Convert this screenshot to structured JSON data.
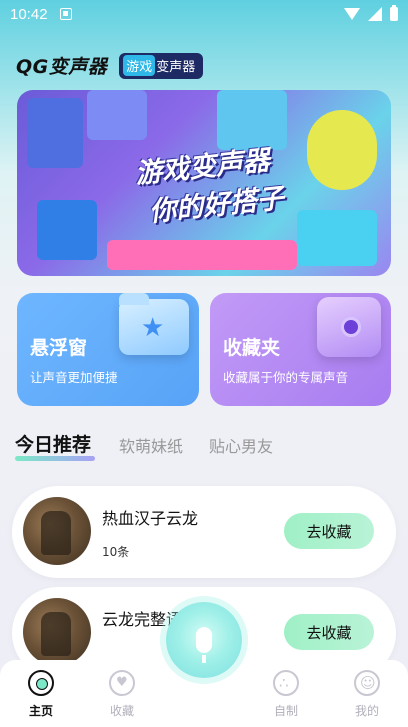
{
  "status_bar": {
    "time": "10:42"
  },
  "header": {
    "app_title": "QG变声器",
    "tag_accent": "游戏",
    "tag_rest": "变声器"
  },
  "banner": {
    "line1": "游戏变声器",
    "line2": "你的好搭子"
  },
  "cards": [
    {
      "title": "悬浮窗",
      "subtitle": "让声音更加便捷",
      "icon": "star-folder-icon"
    },
    {
      "title": "收藏夹",
      "subtitle": "收藏属于你的专属声音",
      "icon": "record-box-icon"
    }
  ],
  "tabs": [
    {
      "label": "今日推荐",
      "active": true
    },
    {
      "label": "软萌妹纸",
      "active": false
    },
    {
      "label": "贴心男友",
      "active": false
    }
  ],
  "list": [
    {
      "title": "热血汉子云龙",
      "count": "10条",
      "button": "去收藏"
    },
    {
      "title": "云龙完整语音",
      "button": "去收藏"
    }
  ],
  "bottom_nav": [
    {
      "label": "主页",
      "active": true
    },
    {
      "label": "收藏",
      "active": false
    },
    {
      "label": "自制",
      "active": false
    },
    {
      "label": "我的",
      "active": false
    }
  ],
  "colors": {
    "accent_green": "#9ff0c6",
    "card_blue": "#6eb6ff",
    "card_purple": "#b48af5",
    "tag_dark": "#1d2a63"
  }
}
